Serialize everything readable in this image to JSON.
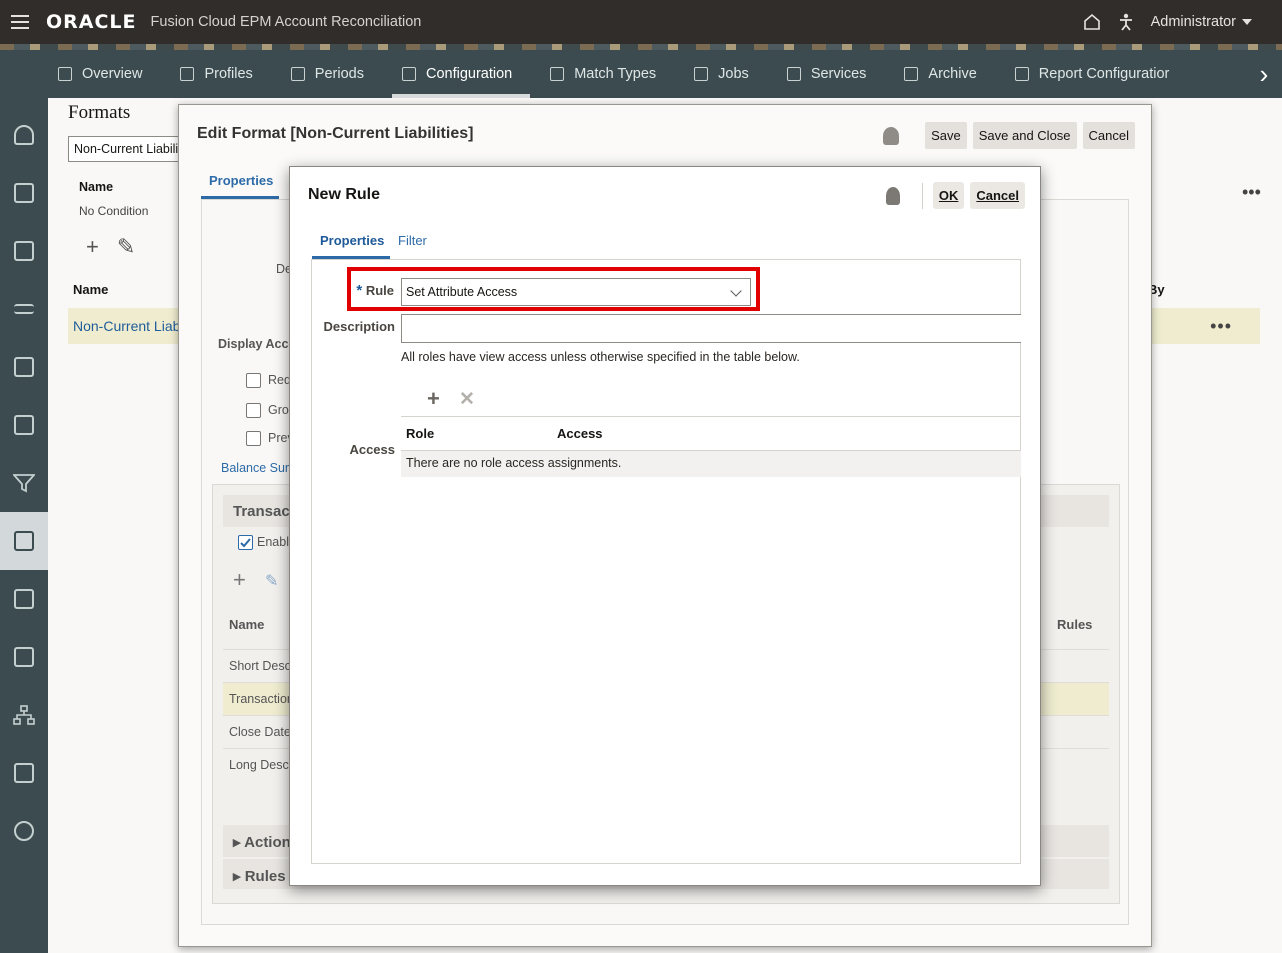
{
  "topbar": {
    "logo": "ORACLE",
    "app_name": "Fusion Cloud EPM Account Reconciliation",
    "user": "Administrator"
  },
  "nav": {
    "tabs": [
      {
        "label": "Overview"
      },
      {
        "label": "Profiles"
      },
      {
        "label": "Periods"
      },
      {
        "label": "Configuration",
        "active": true
      },
      {
        "label": "Match Types"
      },
      {
        "label": "Jobs"
      },
      {
        "label": "Services"
      },
      {
        "label": "Archive"
      },
      {
        "label": "Report Configuratior"
      }
    ]
  },
  "background": {
    "title": "Formats",
    "search_value": "Non-Current Liabili",
    "name_col": "Name",
    "no_condition": "No Condition",
    "name_col2": "Name",
    "row_name": "Non-Current Liab",
    "by_col": "By"
  },
  "edit_dialog": {
    "title": "Edit Format [Non-Current Liabilities]",
    "save": "Save",
    "save_close": "Save and Close",
    "cancel": "Cancel",
    "tab_properties": "Properties",
    "desc_label_partial": "De",
    "display_acc": "Display Acco",
    "req": "Req",
    "gro": "Gro",
    "prev": "Prev",
    "balance_link": "Balance Sum",
    "transact_section": "Transact",
    "enable": "Enable",
    "grid_name": "Name",
    "grid_rules": "Rules",
    "rows": [
      "Short Desc",
      "Transaction",
      "Close Date",
      "Long Descr"
    ],
    "actions_section": "Action",
    "rules_section": "Rules"
  },
  "new_rule": {
    "title": "New Rule",
    "ok": "OK",
    "cancel": "Cancel",
    "tabs": {
      "properties": "Properties",
      "filter": "Filter"
    },
    "required_mark": "*",
    "rule_label": "Rule",
    "rule_value": "Set Attribute Access",
    "description_label": "Description",
    "description_value": "",
    "help_text": "All roles have view access unless otherwise specified in the table below.",
    "access_label": "Access",
    "table": {
      "col_role": "Role",
      "col_access": "Access",
      "empty_message": "There are no role access assignments."
    }
  },
  "colors": {
    "topbar": "#312d2a",
    "navbar": "#3b4b4f",
    "link": "#2d6ba8",
    "highlight_box": "#e00000",
    "selected_row": "#efeccf"
  }
}
